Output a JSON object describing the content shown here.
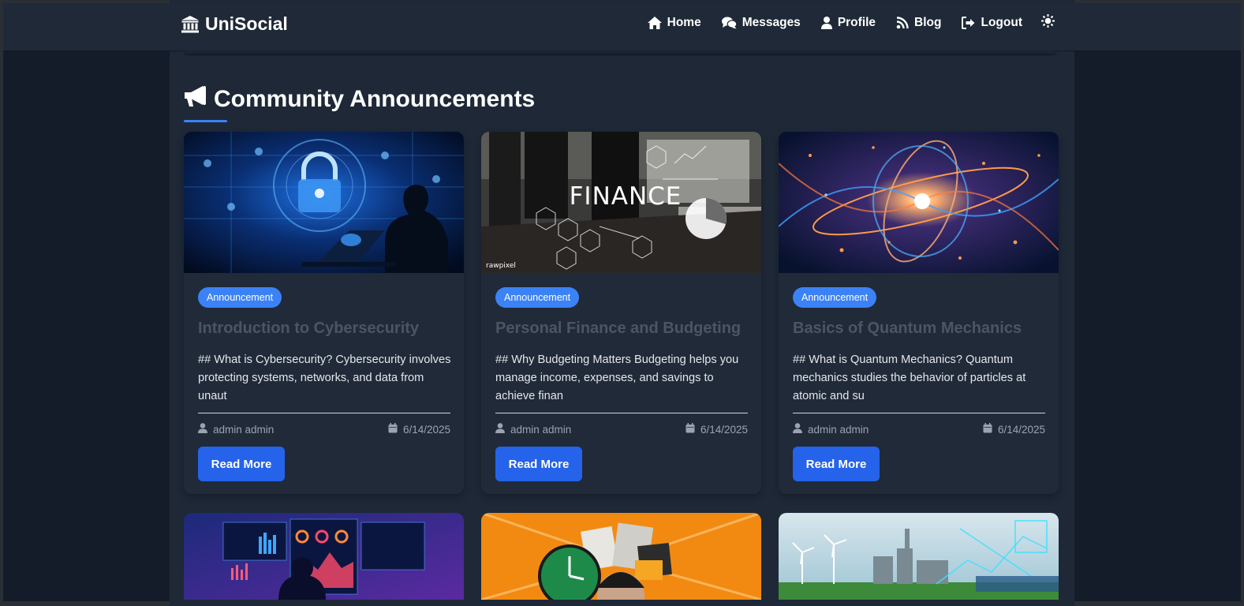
{
  "app": {
    "brand": "UniSocial"
  },
  "nav": {
    "items": [
      {
        "label": "Home",
        "icon": "home-icon"
      },
      {
        "label": "Messages",
        "icon": "comments-icon"
      },
      {
        "label": "Profile",
        "icon": "user-icon"
      },
      {
        "label": "Blog",
        "icon": "rss-icon"
      },
      {
        "label": "Logout",
        "icon": "logout-icon"
      }
    ],
    "theme_toggle_icon": "sun-icon"
  },
  "section": {
    "title": "Community Announcements",
    "icon": "megaphone-icon",
    "accent": "#3b82f6"
  },
  "cards": [
    {
      "badge": "Announcement",
      "title": "Introduction to Cybersecurity",
      "excerpt": "## What is Cybersecurity? Cybersecurity involves protecting systems, networks, and data from unaut",
      "author": "admin admin",
      "date": "6/14/2025",
      "button": "Read More",
      "image": "cybersecurity-image"
    },
    {
      "badge": "Announcement",
      "title": "Personal Finance and Budgeting",
      "excerpt": "## Why Budgeting Matters Budgeting helps you manage income, expenses, and savings to achieve finan",
      "author": "admin admin",
      "date": "6/14/2025",
      "button": "Read More",
      "image": "finance-image",
      "image_text": "FINANCE",
      "image_credit": "rawpixel"
    },
    {
      "badge": "Announcement",
      "title": "Basics of Quantum Mechanics",
      "excerpt": "## What is Quantum Mechanics? Quantum mechanics studies the behavior of particles at atomic and su",
      "author": "admin admin",
      "date": "6/14/2025",
      "button": "Read More",
      "image": "quantum-image"
    }
  ],
  "next_row_images": [
    "data-dashboard-image",
    "time-management-image",
    "renewable-energy-image"
  ],
  "colors": {
    "button": "#2563eb",
    "badge": "#3b82f6",
    "background": "#141c2a",
    "card": "#202a39"
  }
}
